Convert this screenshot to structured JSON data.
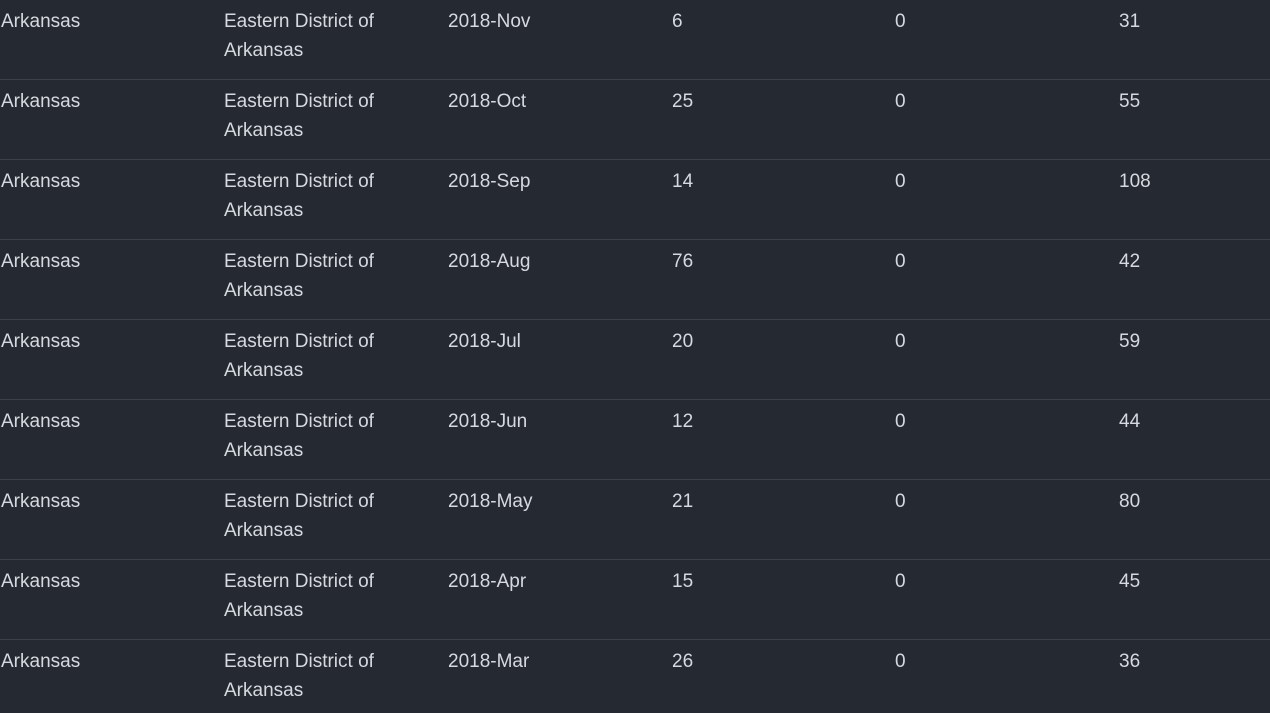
{
  "rows": [
    {
      "state": "Arkansas",
      "district": "Eastern District of Arkansas",
      "month": "2018-Nov",
      "col4": "6",
      "col5": "0",
      "col6": "31"
    },
    {
      "state": "Arkansas",
      "district": "Eastern District of Arkansas",
      "month": "2018-Oct",
      "col4": "25",
      "col5": "0",
      "col6": "55"
    },
    {
      "state": "Arkansas",
      "district": "Eastern District of Arkansas",
      "month": "2018-Sep",
      "col4": "14",
      "col5": "0",
      "col6": "108"
    },
    {
      "state": "Arkansas",
      "district": "Eastern District of Arkansas",
      "month": "2018-Aug",
      "col4": "76",
      "col5": "0",
      "col6": "42"
    },
    {
      "state": "Arkansas",
      "district": "Eastern District of Arkansas",
      "month": "2018-Jul",
      "col4": "20",
      "col5": "0",
      "col6": "59"
    },
    {
      "state": "Arkansas",
      "district": "Eastern District of Arkansas",
      "month": "2018-Jun",
      "col4": "12",
      "col5": "0",
      "col6": "44"
    },
    {
      "state": "Arkansas",
      "district": "Eastern District of Arkansas",
      "month": "2018-May",
      "col4": "21",
      "col5": "0",
      "col6": "80"
    },
    {
      "state": "Arkansas",
      "district": "Eastern District of Arkansas",
      "month": "2018-Apr",
      "col4": "15",
      "col5": "0",
      "col6": "45"
    },
    {
      "state": "Arkansas",
      "district": "Eastern District of Arkansas",
      "month": "2018-Mar",
      "col4": "26",
      "col5": "0",
      "col6": "36"
    }
  ]
}
